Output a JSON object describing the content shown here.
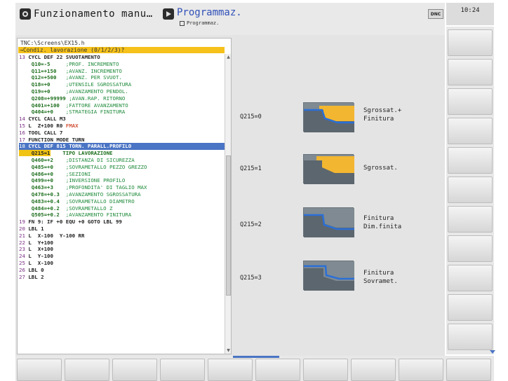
{
  "header": {
    "mode_title": "Funzionamento manu…",
    "program_title": "Programmaz.",
    "program_subtitle": "Programmaz.",
    "dnc_label": "DNC",
    "clock": "10:24"
  },
  "editor": {
    "path": "TNC:\\Screens\\EX15.h",
    "prompt": "→Condiz. lavorazione (0/1/2/3)?",
    "lines": [
      {
        "num": "13",
        "text": " CYCL DEF 22 SVUOTAMENTO",
        "kind": "normal"
      },
      {
        "num": "",
        "q": "    Q10=-5",
        "c": "     ;PROF. INCREMENTO",
        "kind": "param"
      },
      {
        "num": "",
        "q": "    Q11=+150",
        "c": "   ;AVANZ. INCREMENTO",
        "kind": "param"
      },
      {
        "num": "",
        "q": "    Q12=+500",
        "c": "   ;AVANZ. PER SVUOT.",
        "kind": "param"
      },
      {
        "num": "",
        "q": "    Q18=+0",
        "c": "     ;UTENSILE SGROSSATURA",
        "kind": "param"
      },
      {
        "num": "",
        "q": "    Q19=+0",
        "c": "     ;AVANZAMENTO PENDOL.",
        "kind": "param"
      },
      {
        "num": "",
        "q": "    Q208=+99999",
        "c": " ;AVAN.RAP. RITORNO",
        "kind": "param"
      },
      {
        "num": "",
        "q": "    Q401=+100",
        "c": "  ;FATTORE AVANZAMENTO",
        "kind": "param"
      },
      {
        "num": "",
        "q": "    Q404=+0",
        "c": "    ;STRATEGIA FINITURA",
        "kind": "param"
      },
      {
        "num": "14",
        "text": " CYCL CALL M3",
        "kind": "normal"
      },
      {
        "num": "15",
        "text": " L  Z+100 R0 ",
        "fmax": "FMAX",
        "kind": "fmax"
      },
      {
        "num": "16",
        "text": " TOOL CALL 7",
        "kind": "normal"
      },
      {
        "num": "17",
        "text": " FUNCTION MODE TURN",
        "kind": "normal"
      },
      {
        "num": "18",
        "text": " CYCL DEF 815 TORN. PARALL.PROFILO",
        "kind": "selected"
      },
      {
        "num": "",
        "cur": "    Q215=1",
        "hl": "    TIPO LAVORAZIONE",
        "kind": "current"
      },
      {
        "num": "",
        "q": "    Q460=+2",
        "c": "    ;DISTANZA DI SICUREZZA",
        "kind": "param"
      },
      {
        "num": "",
        "q": "    Q485=+0",
        "c": "    ;SOVRAMETALLO PEZZO GREZZO",
        "kind": "param"
      },
      {
        "num": "",
        "q": "    Q486=+0",
        "c": "    ;SEZIONI",
        "kind": "param"
      },
      {
        "num": "",
        "q": "    Q499=+0",
        "c": "    ;INVERSIONE PROFILO",
        "kind": "param"
      },
      {
        "num": "",
        "q": "    Q463=+3",
        "c": "    ;PROFONDITA' DI TAGLIO MAX",
        "kind": "param"
      },
      {
        "num": "",
        "q": "    Q478=+0.3",
        "c": "  ;AVANZAMENTO SGROSSATURA",
        "kind": "param"
      },
      {
        "num": "",
        "q": "    Q483=+0.4",
        "c": "  ;SOVRAMETALLO DIAMETRO",
        "kind": "param"
      },
      {
        "num": "",
        "q": "    Q484=+0.2",
        "c": "  ;SOVRAMETALLO Z",
        "kind": "param"
      },
      {
        "num": "",
        "q": "    Q505=+0.2",
        "c": "  ;AVANZAMENTO FINITURA",
        "kind": "param"
      },
      {
        "num": "19",
        "text": " FN 9: IF +0 EQU +0 GOTO LBL 99",
        "kind": "normal"
      },
      {
        "num": "20",
        "text": " LBL 1",
        "kind": "normal"
      },
      {
        "num": "21",
        "text": " L  X-100  Y-100 RR",
        "kind": "normal"
      },
      {
        "num": "22",
        "text": " L  Y+100",
        "kind": "normal"
      },
      {
        "num": "23",
        "text": " L  X+100",
        "kind": "normal"
      },
      {
        "num": "24",
        "text": " L  Y-100",
        "kind": "normal"
      },
      {
        "num": "25",
        "text": " L  X-100",
        "kind": "normal"
      },
      {
        "num": "26",
        "text": " LBL 0",
        "kind": "normal"
      },
      {
        "num": "27",
        "text": " LBL 2",
        "kind": "normal"
      }
    ]
  },
  "help": [
    {
      "label": "Q215=0",
      "desc": "Sgrossat.+\nFinitura",
      "icon": "roughing-finishing-icon"
    },
    {
      "label": "Q215=1",
      "desc": "Sgrossat.",
      "icon": "roughing-icon"
    },
    {
      "label": "Q215=2",
      "desc": "Finitura\nDim.finita",
      "icon": "finishing-final-icon"
    },
    {
      "label": "Q215=3",
      "desc": "Finitura\nSovramet.",
      "icon": "finishing-allowance-icon"
    }
  ],
  "colors": {
    "accent": "#4a74c4",
    "cursor": "#f1c414",
    "prompt_bar": "#f5c11a",
    "material": "#f2b631",
    "tool_path": "#2b6fd6"
  }
}
